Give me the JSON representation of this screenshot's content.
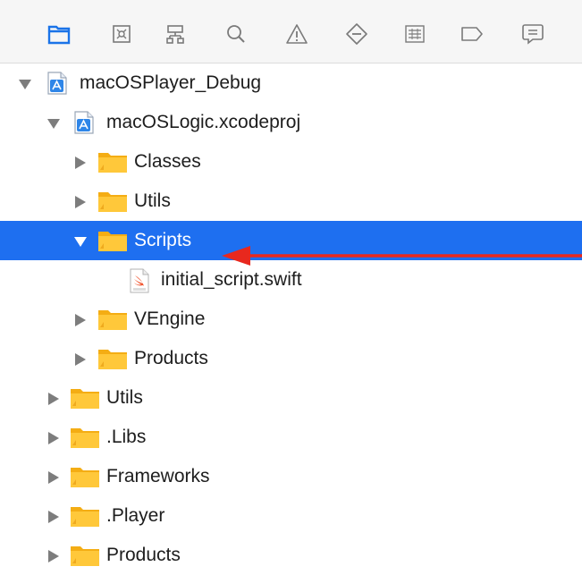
{
  "toolbar": {
    "icons": [
      "project-navigator-icon",
      "source-control-icon",
      "symbol-navigator-icon",
      "find-icon",
      "issue-icon",
      "test-icon",
      "debug-icon",
      "breakpoint-icon",
      "report-icon"
    ],
    "accent_color": "#1e6ff0"
  },
  "tree": {
    "selection_color": "#1e6ff0",
    "rows": [
      {
        "label": "macOSPlayer_Debug",
        "icon": "xcode-project-icon",
        "expanded": true,
        "selected": false
      },
      {
        "label": "macOSLogic.xcodeproj",
        "icon": "xcode-project-icon",
        "expanded": true,
        "selected": false
      },
      {
        "label": "Classes",
        "icon": "folder-icon",
        "expanded": false,
        "selected": false
      },
      {
        "label": "Utils",
        "icon": "folder-icon",
        "expanded": false,
        "selected": false
      },
      {
        "label": "Scripts",
        "icon": "folder-icon",
        "expanded": true,
        "selected": true
      },
      {
        "label": "initial_script.swift",
        "icon": "swift-file-icon",
        "expanded": null,
        "selected": false
      },
      {
        "label": "VEngine",
        "icon": "folder-icon",
        "expanded": false,
        "selected": false
      },
      {
        "label": "Products",
        "icon": "folder-icon",
        "expanded": false,
        "selected": false
      },
      {
        "label": "Utils",
        "icon": "folder-icon",
        "expanded": false,
        "selected": false
      },
      {
        "label": ".Libs",
        "icon": "folder-icon",
        "expanded": false,
        "selected": false
      },
      {
        "label": "Frameworks",
        "icon": "folder-icon",
        "expanded": false,
        "selected": false
      },
      {
        "label": ".Player",
        "icon": "folder-icon",
        "expanded": false,
        "selected": false
      },
      {
        "label": "Products",
        "icon": "folder-icon",
        "expanded": false,
        "selected": false
      }
    ]
  },
  "annotation": {
    "arrow_color": "#e8281e"
  }
}
